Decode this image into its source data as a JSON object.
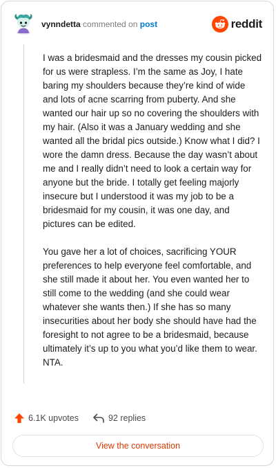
{
  "header": {
    "username": "vynndetta",
    "action_text": "commented on",
    "post_link": "post",
    "brand_name": "reddit",
    "avatar_icon": "snoo-avatar-icon",
    "brand_icon": "reddit-logo-icon"
  },
  "comment": {
    "paragraphs": [
      "I was a bridesmaid and the dresses my cousin picked for us were strapless. I’m the same as Joy, I hate baring my shoulders because they’re kind of wide and lots of acne scarring from puberty. And she wanted our hair up so no covering the shoulders with my hair. (Also it was a January wedding and she wanted all the bridal pics outside.) Know what I did? I wore the damn dress. Because the day wasn’t about me and I really didn’t need to look a certain way for anyone but the bride. I totally get feeling majorly insecure but I understood it was my job to be a bridesmaid for my cousin, it was one day, and pictures can be edited.",
      "You gave her a lot of choices, sacrificing YOUR preferences to help everyone feel comfortable, and she still made it about her. You even wanted her to still come to the wedding (and she could wear whatever she wants then.) If she has so many insecurities about her body she should have had the foresight to not agree to be a bridesmaid, because ultimately it’s up to you what you’d like them to wear. NTA."
    ]
  },
  "stats": {
    "upvotes": "6.1K upvotes",
    "replies": "92 replies",
    "upvote_icon": "upvote-arrow-icon",
    "reply_icon": "reply-arrow-icon"
  },
  "actions": {
    "view_conversation": "View the conversation"
  },
  "colors": {
    "brand": "#ff4500",
    "link": "#0079d3",
    "button_text": "#d93a00",
    "muted": "#7c7c7c"
  }
}
